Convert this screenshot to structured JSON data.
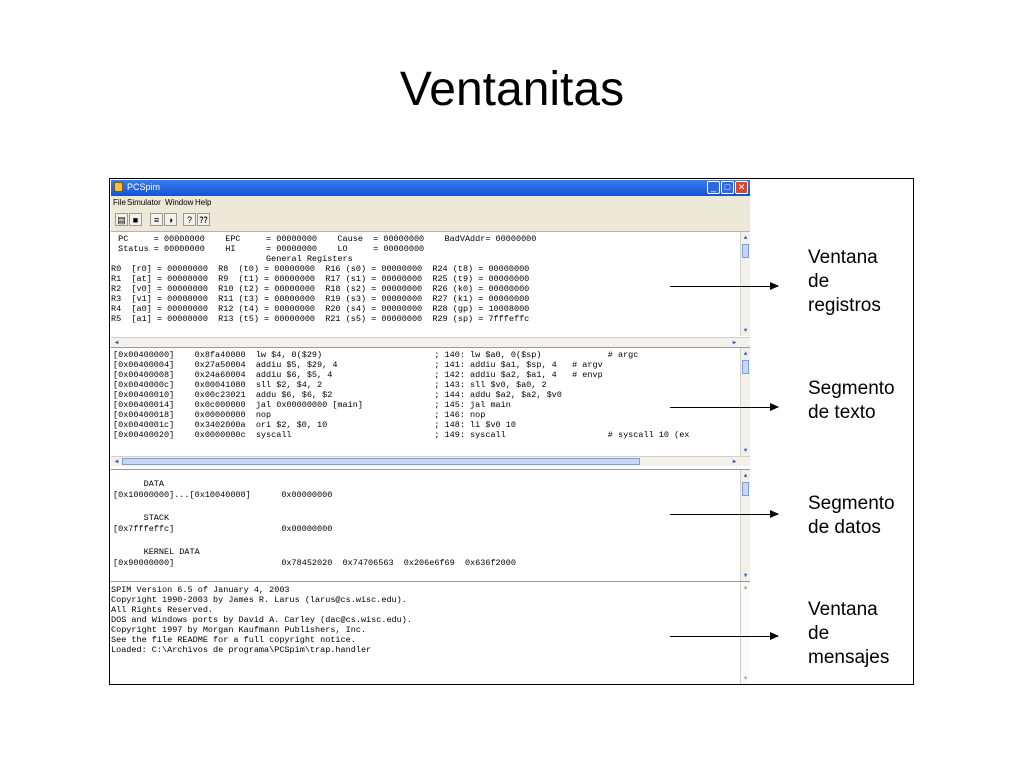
{
  "slide": {
    "title": "Ventanitas"
  },
  "window": {
    "title": "PCSpim",
    "menu": [
      "File",
      "Simulator",
      "Window",
      "Help"
    ],
    "toolbar": [
      "open-icon",
      "save-icon",
      "run-icon",
      "breakpoint-icon",
      "help-icon",
      "context-help-icon"
    ]
  },
  "registers": {
    "lines": [
      " PC     = 00000000    EPC     = 00000000    Cause  = 00000000    BadVAddr= 00000000",
      " Status = 00000000    HI      = 00000000    LO     = 00000000",
      "                              General Registers",
      "R0  [r0] = 00000000  R8  (t0) = 00000000  R16 (s0) = 00000000  R24 (t8) = 00000000",
      "R1  [at] = 00000000  R9  (t1) = 00000000  R17 (s1) = 00000000  R25 (t9) = 00000000",
      "R2  [v0] = 00000000  R10 (t2) = 00000000  R18 (s2) = 00000000  R26 (k0) = 00000000",
      "R3  [v1] = 00000000  R11 (t3) = 00000000  R19 (s3) = 00000000  R27 (k1) = 00000000",
      "R4  [a0] = 00000000  R12 (t4) = 00000000  R20 (s4) = 00000000  R28 (gp) = 10008000",
      "R5  [a1] = 00000000  R13 (t5) = 00000000  R21 (s5) = 00000000  R29 (sp) = 7fffeffc"
    ]
  },
  "text_segment": {
    "lines": [
      "[0x00400000]    0x8fa40000  lw $4, 0($29)                      ; 140: lw $a0, 0($sp)             # argc",
      "[0x00400004]    0x27a50004  addiu $5, $29, 4                   ; 141: addiu $a1, $sp, 4   # argv",
      "[0x00400008]    0x24a60004  addiu $6, $5, 4                    ; 142: addiu $a2, $a1, 4   # envp",
      "[0x0040000c]    0x00041080  sll $2, $4, 2                      ; 143: sll $v0, $a0, 2",
      "[0x00400010]    0x00c23021  addu $6, $6, $2                    ; 144: addu $a2, $a2, $v0",
      "[0x00400014]    0x0c000000  jal 0x00000000 [main]              ; 145: jal main",
      "[0x00400018]    0x00000000  nop                                ; 146: nop",
      "[0x0040001c]    0x3402000a  ori $2, $0, 10                     ; 148: li $v0 10",
      "[0x00400020]    0x0000000c  syscall                            ; 149: syscall                    # syscall 10 (ex"
    ]
  },
  "data_segment": {
    "lines": [
      "      DATA",
      "[0x10000000]...[0x10040000]      0x00000000",
      "",
      "      STACK",
      "[0x7fffeffc]                     0x00000000",
      "",
      "      KERNEL DATA",
      "[0x90000000]                     0x78452020  0x74706563  0x206e6f69  0x636f2000"
    ]
  },
  "messages": {
    "lines": [
      "SPIM Version 6.5 of January 4, 2003",
      "Copyright 1990-2003 by James R. Larus (larus@cs.wisc.edu).",
      "All Rights Reserved.",
      "DOS and Windows ports by David A. Carley (dac@cs.wisc.edu).",
      "Copyright 1997 by Morgan Kaufmann Publishers, Inc.",
      "See the file README for a full copyright notice.",
      "Loaded: C:\\Archivos de programa\\PCSpim\\trap.handler"
    ]
  },
  "callouts": [
    {
      "lines": [
        "Ventana",
        "de",
        "registros"
      ]
    },
    {
      "lines": [
        "Segmento",
        "de texto"
      ]
    },
    {
      "lines": [
        "Segmento",
        "de datos"
      ]
    },
    {
      "lines": [
        "Ventana",
        "de",
        "mensajes"
      ]
    }
  ]
}
